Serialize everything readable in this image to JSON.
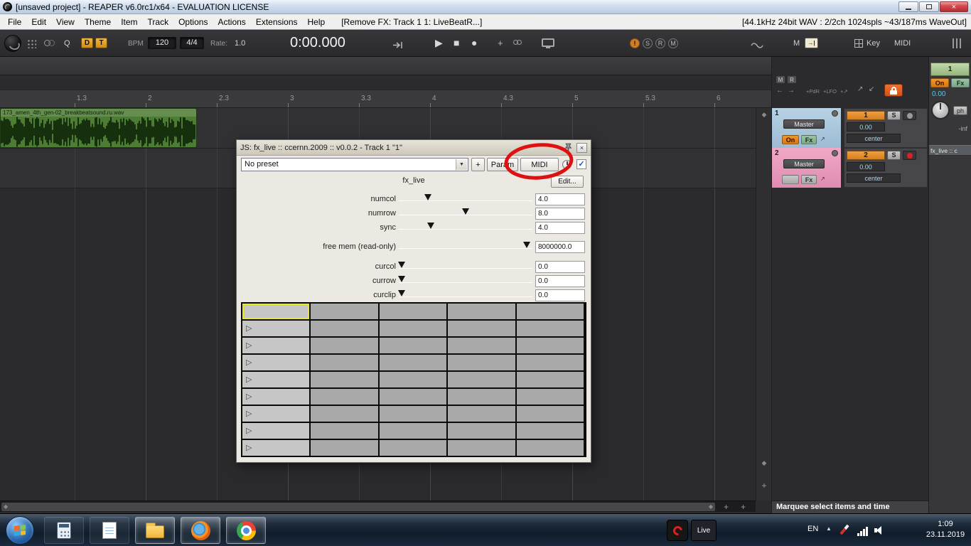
{
  "window": {
    "title": "[unsaved project] - REAPER v6.0rc1/x64 - EVALUATION LICENSE"
  },
  "menubar": {
    "items": [
      "File",
      "Edit",
      "View",
      "Theme",
      "Item",
      "Track",
      "Options",
      "Actions",
      "Extensions",
      "Help"
    ],
    "action_hint": "[Remove FX: Track 1 1: LiveBeatR...]",
    "audio_status": "[44.1kHz 24bit WAV : 2/2ch 1024spls ~43/187ms WaveOut]"
  },
  "transport": {
    "q": "Q",
    "d": "D",
    "t": "T",
    "bpm_label": "BPM",
    "bpm": "120",
    "timesig": "4/4",
    "rate_label": "Rate:",
    "rate": "1.0",
    "time": "0:00.000",
    "indicators": [
      "!",
      "S",
      "R",
      "M"
    ],
    "m_label": "M",
    "key_label": "Key",
    "midi_label": "MIDI"
  },
  "ruler": {
    "ticks": [
      "1.3",
      "2",
      "2.3",
      "3",
      "3.3",
      "4",
      "4.3",
      "5",
      "5.3",
      "6"
    ]
  },
  "arrange": {
    "item_name": "173_amen_4th_gen-02_breakbeatsound.ru.wav"
  },
  "right_panel": {
    "m": "M",
    "r": "R",
    "routing_hints": [
      "+PdR",
      "+LFO",
      "+↗"
    ],
    "tracks": [
      {
        "num": "1",
        "route": "Master",
        "btn1": "On",
        "btn2": "Fx"
      },
      {
        "num": "2",
        "route": "Master",
        "btn1": "",
        "btn2": "Fx"
      }
    ],
    "mixer_rows": [
      {
        "num": "1",
        "solo": "S",
        "vol": "0.00",
        "pan": "center"
      },
      {
        "num": "2",
        "solo": "S",
        "vol": "0.00",
        "pan": "center"
      }
    ],
    "status": "Marquee select items and time"
  },
  "mixer_strip": {
    "num": "1",
    "on": "On",
    "fx": "Fx",
    "vol": "0.00",
    "ph": "ph",
    "peak": "-inf",
    "fx_slot": "fx_live :: c"
  },
  "fx_window": {
    "title": "JS: fx_live :: ccernn.2009 :: v0.0.2 - Track 1 \"1\"",
    "preset": "No preset",
    "add": "+",
    "param": "Param",
    "midi": "MIDI",
    "plugin_title": "fx_live",
    "edit": "Edit...",
    "sliders": [
      {
        "label": "numcol",
        "value": "4.0",
        "pos": 22
      },
      {
        "label": "numrow",
        "value": "8.0",
        "pos": 50
      },
      {
        "label": "sync",
        "value": "4.0",
        "pos": 24
      },
      {
        "label": "free mem (read-only)",
        "value": "8000000.0",
        "pos": 96
      },
      {
        "label": "curcol",
        "value": "0.0",
        "pos": 2
      },
      {
        "label": "currow",
        "value": "0.0",
        "pos": 2
      },
      {
        "label": "curclip",
        "value": "0.0",
        "pos": 2
      }
    ],
    "grid": {
      "rows": 9,
      "cols": 5,
      "play_rows_start": 1,
      "selected_cell": {
        "row": 0,
        "col": 0
      }
    }
  },
  "taskbar": {
    "live": "Live",
    "lang": "EN",
    "time": "1:09",
    "date": "23.11.2019"
  },
  "colors": {
    "annotation_red": "#dd1111",
    "track1_panel": "#a9c6dc",
    "track2_panel": "#ec9cbe",
    "on_button_orange": "#e08018",
    "item_green": "#4d7c35"
  }
}
